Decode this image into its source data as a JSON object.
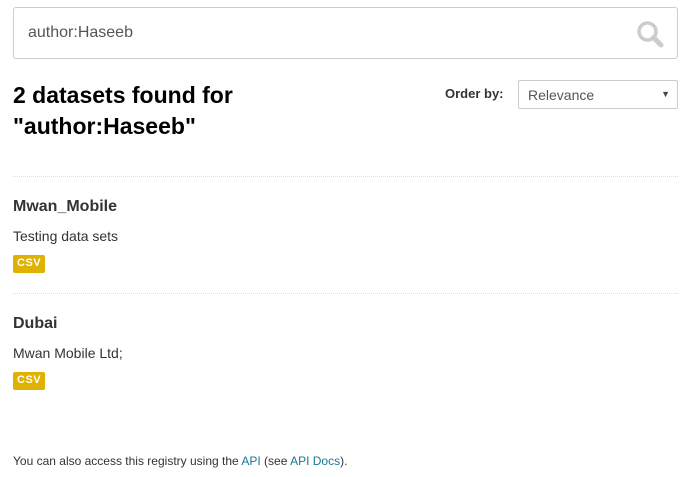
{
  "search": {
    "value": "author:Haseeb",
    "icon": "search-icon"
  },
  "results": {
    "heading_line1": "2 datasets found for",
    "heading_line2": "\"author:Haseeb\""
  },
  "order": {
    "label": "Order by:",
    "selected": "Relevance"
  },
  "datasets": [
    {
      "title": "Mwan_Mobile",
      "notes": "Testing data sets",
      "format": "CSV"
    },
    {
      "title": "Dubai",
      "notes": "Mwan Mobile Ltd;",
      "format": "CSV"
    }
  ],
  "footer": {
    "text_before": "You can also access this registry using the ",
    "api_link": "API",
    "text_middle": " (see ",
    "docs_link": "API Docs",
    "text_after": ")."
  },
  "colors": {
    "badge": "#dfb100",
    "link": "#187794",
    "icon": "#cccccc"
  }
}
